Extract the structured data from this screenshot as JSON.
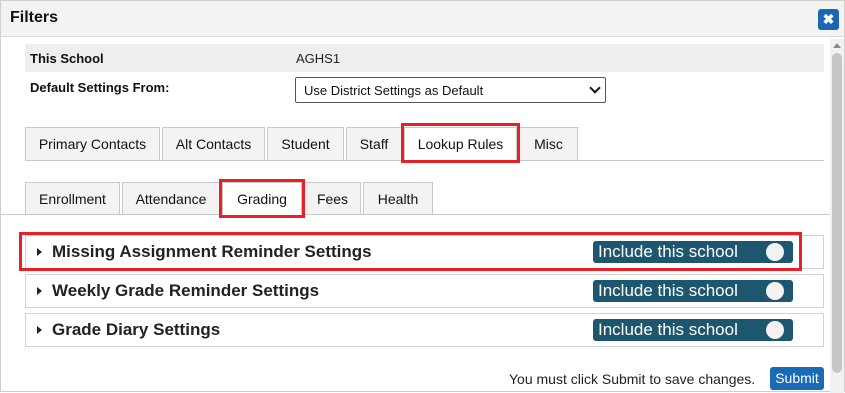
{
  "dialog": {
    "title": "Filters",
    "close_label": "✖"
  },
  "school": {
    "label": "This School",
    "value": "AGHS1",
    "default_label": "Default Settings From:",
    "default_value": "Use District Settings as Default"
  },
  "tabs_primary": [
    "Primary Contacts",
    "Alt Contacts",
    "Student",
    "Staff",
    "Lookup Rules",
    "Misc"
  ],
  "tabs_secondary": [
    "Enrollment",
    "Attendance",
    "Grading",
    "Fees",
    "Health"
  ],
  "sections": [
    {
      "title": "Missing Assignment Reminder Settings",
      "toggle_label": "Include this school"
    },
    {
      "title": "Weekly Grade Reminder Settings",
      "toggle_label": "Include this school"
    },
    {
      "title": "Grade Diary Settings",
      "toggle_label": "Include this school"
    }
  ],
  "footer": {
    "message": "You must click Submit to save changes.",
    "submit_label": "Submit"
  },
  "colors": {
    "highlight": "#e8202a",
    "toggle_bg": "#1d566f",
    "accent": "#1a6bb6"
  }
}
